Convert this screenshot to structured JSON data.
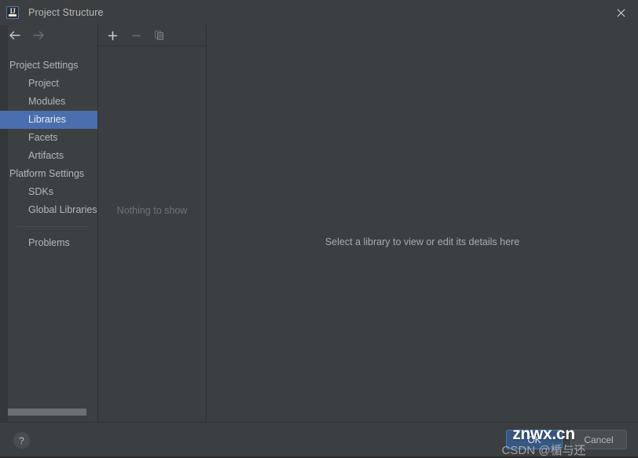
{
  "window": {
    "title": "Project Structure",
    "logo_text": "IJ",
    "close_icon": "close-icon"
  },
  "navigation": {
    "back_icon": "arrow-left-icon",
    "forward_icon": "arrow-right-icon"
  },
  "sidebar": {
    "items": [
      {
        "label": "Project Settings",
        "type": "group",
        "selected": false
      },
      {
        "label": "Project",
        "type": "child",
        "selected": false
      },
      {
        "label": "Modules",
        "type": "child",
        "selected": false
      },
      {
        "label": "Libraries",
        "type": "child",
        "selected": true
      },
      {
        "label": "Facets",
        "type": "child",
        "selected": false
      },
      {
        "label": "Artifacts",
        "type": "child",
        "selected": false
      },
      {
        "label": "Platform Settings",
        "type": "group",
        "selected": false
      },
      {
        "label": "SDKs",
        "type": "child",
        "selected": false
      },
      {
        "label": "Global Libraries",
        "type": "child",
        "selected": false
      }
    ],
    "footer_items": [
      {
        "label": "Problems",
        "type": "child",
        "selected": false
      }
    ]
  },
  "list_panel": {
    "toolbar": [
      {
        "name": "add-button",
        "icon": "plus-icon",
        "enabled": true
      },
      {
        "name": "remove-button",
        "icon": "minus-icon",
        "enabled": false
      },
      {
        "name": "copy-button",
        "icon": "copy-icon",
        "enabled": false
      }
    ],
    "empty_text": "Nothing to show"
  },
  "detail_panel": {
    "hint": "Select a library to view or edit its details here"
  },
  "footer": {
    "help_label": "?",
    "ok_label": "OK",
    "cancel_label": "Cancel"
  },
  "watermarks": {
    "primary": "znwx.cn",
    "secondary": "CSDN @楯与还"
  },
  "colors": {
    "dialog_background": "#3c3f41",
    "sidebar_background": "#3c4043",
    "selection_blue": "#4b6eaf",
    "primary_button": "#365880",
    "text_primary": "#b4b7ba",
    "text_muted": "#6f7375"
  }
}
